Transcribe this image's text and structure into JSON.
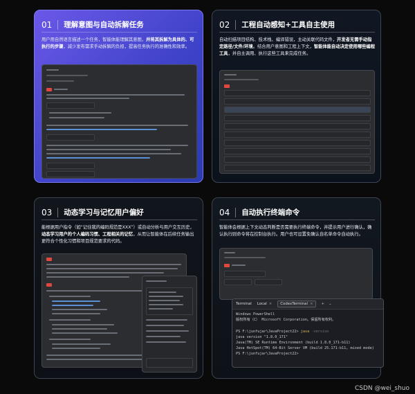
{
  "cards": [
    {
      "num": "01",
      "title": "理解意图与自动拆解任务",
      "desc_parts": [
        {
          "t": "用户用自然语言描述一个任务，智能体能理解其意图，",
          "b": false
        },
        {
          "t": "并将其拆解为具体的、可执行的步骤",
          "b": true
        },
        {
          "t": "，减少发布需求手动拆解的负担，提高任务执行的准确性和效率。",
          "b": false
        }
      ]
    },
    {
      "num": "02",
      "title": "工程自动感知+工具自主使用",
      "desc_parts": [
        {
          "t": "自动扫描项目结构、技术栈、编译错误，主动关联代码文件，",
          "b": false
        },
        {
          "t": "开发者无需手动指定路径/文件/环境",
          "b": true
        },
        {
          "t": "。结合用户意图和工程上下文，",
          "b": false
        },
        {
          "t": "智能体能自动决定使用哪些编程工具",
          "b": true
        },
        {
          "t": "，并自主调用、执行这些工具来完成任务。",
          "b": false
        }
      ]
    },
    {
      "num": "03",
      "title": "动态学习与记忆用户偏好",
      "desc_parts": [
        {
          "t": "能根据用户指令（如“记住我的编码规范是XXX”）或自动分析与用户交互历史，",
          "b": false
        },
        {
          "t": "动态学习用户的个人编码习惯、工程相关的记忆",
          "b": true
        },
        {
          "t": "，从而让智能体在后续任务输出更符合个性化习惯和项目规范要求的代码。",
          "b": false
        }
      ]
    },
    {
      "num": "04",
      "title": "自动执行终端命令",
      "desc_parts": [
        {
          "t": "智能体会根据上下文动态判断是否需要执行终端命令，并提示用户进行确认，确认执行则命令将在控制台执行。用户也可设置免确认自名单命令自动执行。",
          "b": false
        }
      ]
    }
  ],
  "terminal": {
    "tabs": [
      "Terminal",
      "Local",
      "CodexTerminal"
    ],
    "controls": [
      "+",
      "⌄"
    ],
    "lines": [
      {
        "text": "Windows PowerShell",
        "cls": ""
      },
      {
        "text": "版权所有（C） Microsoft Corporation。保留所有权利。",
        "cls": ""
      },
      {
        "text": "",
        "cls": ""
      },
      {
        "text": "PS F:\\junfujar\\JavaProject22> java -version",
        "cls": "cmd"
      },
      {
        "text": "java version \"1.8.0_171\"",
        "cls": ""
      },
      {
        "text": "Java(TM) SE Runtime Environment (build 1.8.0_171-b11)",
        "cls": ""
      },
      {
        "text": "Java HotSpot(TM) 64-Bit Server VM (build 25.171-b11, mixed mode)",
        "cls": ""
      },
      {
        "text": "PS F:\\junfujar\\JavaProject22>",
        "cls": ""
      }
    ]
  },
  "watermark": "CSDN @wei_shuo"
}
